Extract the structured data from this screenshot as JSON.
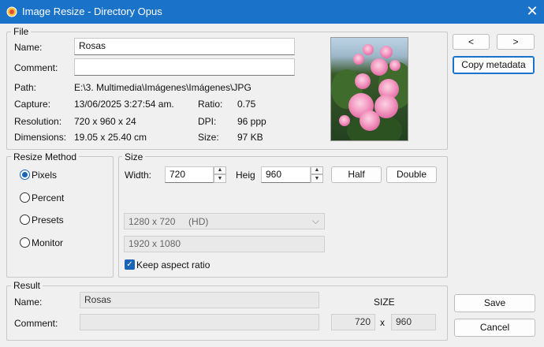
{
  "window": {
    "title": "Image Resize - Directory Opus"
  },
  "file": {
    "legend": "File",
    "name_label": "Name:",
    "name_value": "Rosas",
    "comment_label": "Comment:",
    "comment_value": "",
    "path_label": "Path:",
    "path_value": "E:\\3. Multimedia\\Imágenes\\Imágenes\\JPG",
    "capture_label": "Capture:",
    "capture_value": "13/06/2025 3:27:54 am.",
    "ratio_label": "Ratio:",
    "ratio_value": "0.75",
    "resolution_label": "Resolution:",
    "resolution_value": "720 x 960 x 24",
    "dpi_label": "DPI:",
    "dpi_value": "96 ppp",
    "dimensions_label": "Dimensions:",
    "dimensions_value": "19.05 x 25.40 cm",
    "size_label": "Size:",
    "size_value": "97 KB"
  },
  "nav": {
    "prev_label": "<",
    "next_label": ">",
    "copy_metadata_label": "Copy metadata"
  },
  "resize_method": {
    "legend": "Resize Method",
    "options": [
      {
        "label": "Pixels",
        "checked": true
      },
      {
        "label": "Percent",
        "checked": false
      },
      {
        "label": "Presets",
        "checked": false
      },
      {
        "label": "Monitor",
        "checked": false
      }
    ]
  },
  "size": {
    "legend": "Size",
    "width_label": "Width:",
    "width_value": "720",
    "height_label": "Heig",
    "height_value": "960",
    "half_label": "Half",
    "double_label": "Double",
    "preset_value": "1280 x 720     (HD)",
    "monitor_value": "1920 x 1080",
    "keep_aspect_label": "Keep aspect ratio",
    "keep_aspect_checked": true
  },
  "result": {
    "legend": "Result",
    "name_label": "Name:",
    "name_value": "Rosas",
    "comment_label": "Comment:",
    "comment_value": "",
    "size_heading": "SIZE",
    "width_value": "720",
    "times": "x",
    "height_value": "960"
  },
  "actions": {
    "save_label": "Save",
    "cancel_label": "Cancel"
  },
  "colors": {
    "accent": "#1a73c9",
    "radio_check": "#1a64b8"
  }
}
